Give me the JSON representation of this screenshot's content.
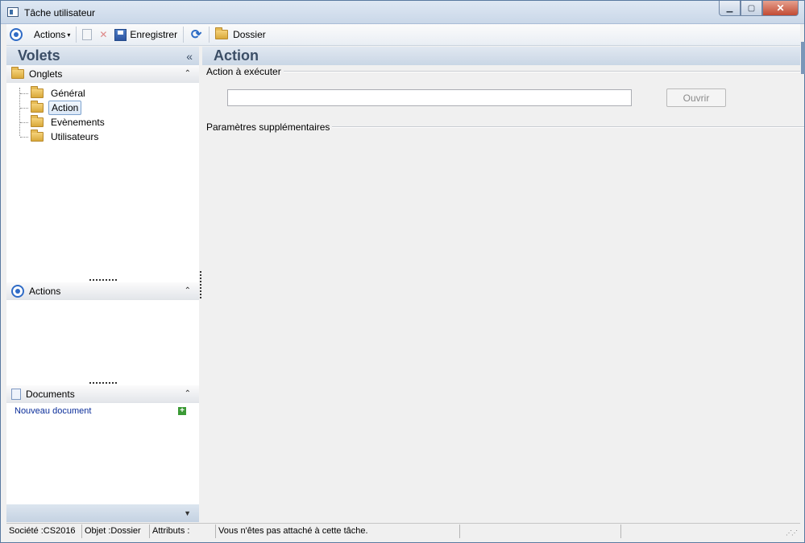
{
  "window": {
    "title": "Tâche utilisateur"
  },
  "window_buttons": {
    "minimize": "▁",
    "maximize": "▢",
    "close": "✕"
  },
  "toolbar": {
    "actions_label": "Actions",
    "caret": "▾",
    "delete_glyph": "✕",
    "save_label": "Enregistrer",
    "refresh_glyph": "⟳",
    "folder_label": "Dossier"
  },
  "left_panel": {
    "title": "Volets",
    "collapse_glyph": "«",
    "expand_up_glyph": "⌃",
    "sections": {
      "tabs": {
        "title": "Onglets"
      },
      "actions": {
        "title": "Actions"
      },
      "documents": {
        "title": "Documents",
        "new_document": "Nouveau document",
        "plus_glyph": "+"
      }
    },
    "tree_items": [
      {
        "label": "Général",
        "selected": false
      },
      {
        "label": "Action",
        "selected": true
      },
      {
        "label": "Evènements",
        "selected": false
      },
      {
        "label": "Utilisateurs",
        "selected": false
      }
    ],
    "bottom_glyph": "▼"
  },
  "main": {
    "title": "Action",
    "action_group_label": "Action à exécuter",
    "action_input_value": "",
    "open_button": "Ouvrir",
    "params_group_label": "Paramètres supplémentaires"
  },
  "statusbar": {
    "company": "Société :CS2016",
    "object": "Objet :Dossier",
    "attributes": "Attributs :",
    "message": "Vous n'êtes pas attaché à cette tâche.",
    "grip": "⋰⋰"
  },
  "colors": {
    "header_text": "#3b4e66",
    "link": "#0b2e9a",
    "accent": "#2f6bc6"
  }
}
